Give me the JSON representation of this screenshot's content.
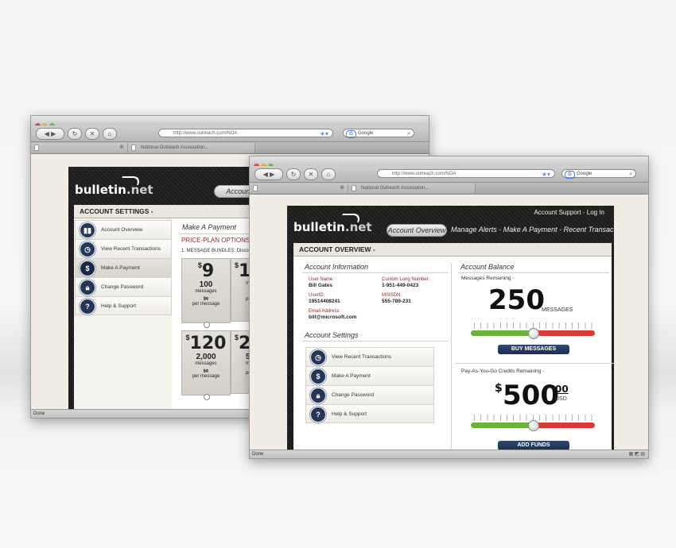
{
  "browser": {
    "url": "http://www.outreach.com/NOA",
    "search_placeholder": "Google",
    "status": "Done",
    "tab_label": "National Outreach Association..."
  },
  "brand": {
    "logo_main": "bulletin",
    "logo_net": ".net"
  },
  "back_window": {
    "nav_active": "Account Ove",
    "section_title": "ACCOUNT SETTINGS -",
    "menu": [
      {
        "label": "Account Overview",
        "icon": "chart-icon"
      },
      {
        "label": "View Recent Transactions",
        "icon": "clock-icon"
      },
      {
        "label": "Make A Payment",
        "icon": "dollar-icon"
      },
      {
        "label": "Change Password",
        "icon": "lock-icon"
      },
      {
        "label": "Help & Support",
        "icon": "question-icon"
      }
    ],
    "payment_title": "Make A Payment",
    "price_plan": "PRICE-PLAN OPTIONS",
    "price_plan_suffix": "(y",
    "bundles_label": "1. MESSAGE BUNDLES: Disco",
    "cards": [
      {
        "dollar": "$",
        "price": "9",
        "count": "100",
        "count_unit": "messages",
        "rate": "9¢",
        "rate_unit": "per message"
      },
      {
        "dollar": "$",
        "price": "1",
        "count": "",
        "count_unit": "me",
        "rate": "",
        "rate_unit": "per"
      },
      {
        "dollar": "$",
        "price": "120",
        "count": "2,000",
        "count_unit": "messages",
        "rate": "6¢",
        "rate_unit": "per message"
      },
      {
        "dollar": "$",
        "price": "2",
        "count": "5,",
        "count_unit": "me",
        "rate": "",
        "rate_unit": "per"
      }
    ]
  },
  "front_window": {
    "top_links": {
      "support": "Account Support",
      "sep": "-",
      "login": "Log In"
    },
    "nav": {
      "active": "Account Overview",
      "items": [
        "Manage Alerts",
        "Make A Payment",
        "Recent Transactions"
      ],
      "sep": "-"
    },
    "section_title": "ACCOUNT OVERVIEW -",
    "account_info": {
      "heading": "Account Information",
      "fields": [
        {
          "label": "User Name:",
          "value": "Bill Gates"
        },
        {
          "label": "UserID:",
          "value": "19514408241"
        },
        {
          "label": "Email Address:",
          "value": "bill@microsoft.com"
        },
        {
          "label": "Custom Long Number:",
          "value": "1-951-449-0423"
        },
        {
          "label": "MSISDN:",
          "value": "555-789-231"
        }
      ]
    },
    "account_settings": {
      "heading": "Account Settings",
      "items": [
        {
          "label": "View Recent Transactions",
          "icon": "clock-icon"
        },
        {
          "label": "Make A Payment",
          "icon": "dollar-icon"
        },
        {
          "label": "Change Password",
          "icon": "lock-icon"
        },
        {
          "label": "Help & Support",
          "icon": "question-icon"
        }
      ]
    },
    "balance": {
      "heading": "Account Balance",
      "messages_label": "Messages Remaining -",
      "messages_value": "250",
      "messages_unit": "MESSAGES",
      "messages_level": 0.5,
      "buy_button": "BUY MESSAGES",
      "credits_label": "Pay-As-You-Go Credits Remaining -",
      "credits_dollar": "$",
      "credits_value": "500",
      "credits_cents": "00",
      "credits_unit": "USD",
      "credits_level": 0.5,
      "add_button": "ADD FUNDS"
    }
  },
  "colors": {
    "navy": "#253756",
    "green": "#6bb13a",
    "red": "#d93a35",
    "accent_red": "#8b2a2a"
  }
}
